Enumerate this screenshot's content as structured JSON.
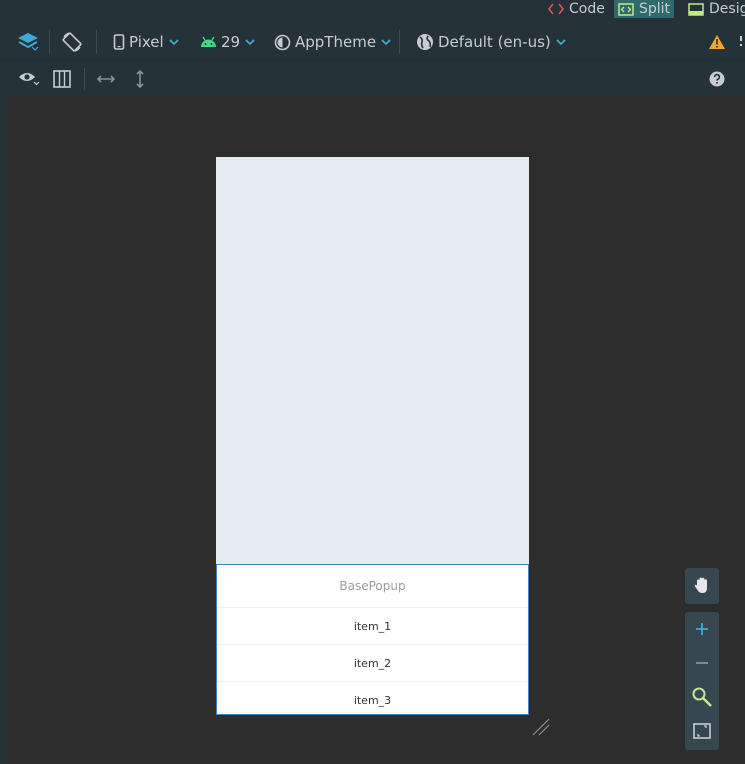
{
  "editor_modes": [
    {
      "label": "Code",
      "icon": "code-icon",
      "color": "#e05555"
    },
    {
      "label": "Split",
      "icon": "split-icon",
      "color": "#c3e88d"
    },
    {
      "label": "Desig",
      "icon": "design-icon",
      "color": "#c3e88d"
    }
  ],
  "toolbar": {
    "device": "Pixel",
    "api_level": "29",
    "theme": "AppTheme",
    "locale": "Default (en-us)"
  },
  "popup": {
    "title": "BasePopup",
    "items": [
      "item_1",
      "item_2",
      "item_3"
    ]
  },
  "colors": {
    "accent": "#3ca9d6",
    "android_green": "#3ddc84",
    "warning": "#f0a732",
    "device_background": "#e3ebee",
    "selection_border": "#3f82c6"
  }
}
